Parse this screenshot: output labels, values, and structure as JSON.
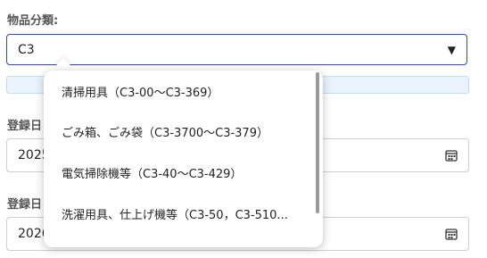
{
  "form": {
    "category_label": "物品分類:",
    "category_value": "C3",
    "date1_label": "登録日",
    "date1_value": "2025.",
    "date2_label": "登録日",
    "date2_value": "2026."
  },
  "dropdown": {
    "options": [
      "清掃用具（C3-00〜C3-369）",
      "ごみ箱、ごみ袋（C3-3700〜C3-379）",
      "電気掃除機等（C3-40〜C3-429）",
      "洗濯用具、仕上げ機等（C3-50，C3-510..."
    ]
  },
  "icons": {
    "select_arrow": "▼",
    "calendar": "calendar-icon"
  },
  "colors": {
    "accent": "#2f4fa8",
    "hint_bg": "#eaf3ff"
  }
}
